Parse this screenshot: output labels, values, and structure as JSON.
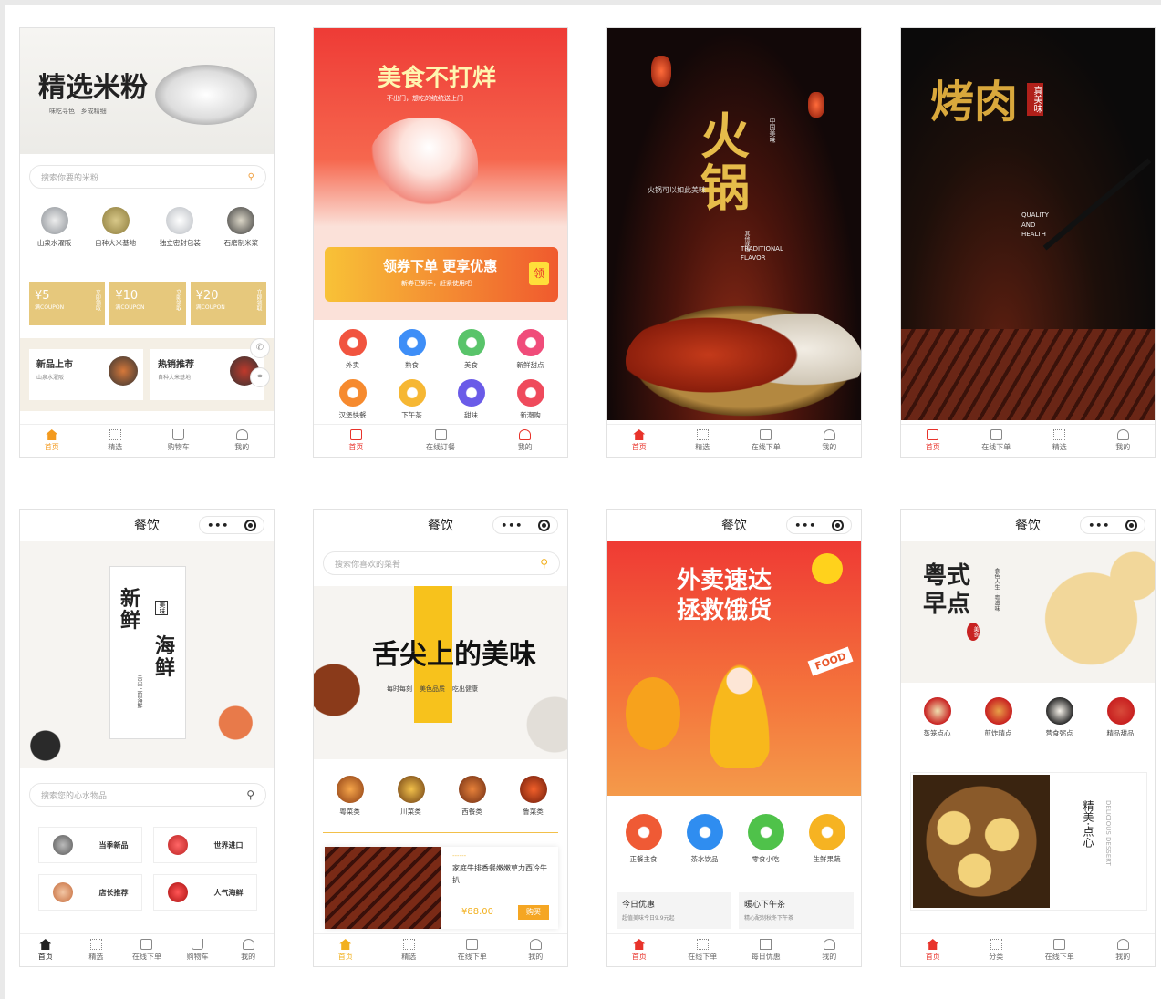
{
  "colors": {
    "accent": "#e8332b",
    "orange": "#f6a623",
    "gold": "#d9b24a"
  },
  "cards": {
    "c1": {
      "banner_title": "精选米粉",
      "banner_sub": "味吃寻色 · 乡成精细",
      "search_placeholder": "搜索你要的米粉",
      "categories": [
        "山泉水濯阪",
        "自种大米基地",
        "独立密封包装",
        "石磨制米浆"
      ],
      "coupons": [
        {
          "amount": "¥5",
          "label": "满COUPON",
          "side": "立即领取"
        },
        {
          "amount": "¥10",
          "label": "满COUPON",
          "side": "立即领取"
        },
        {
          "amount": "¥20",
          "label": "满COUPON",
          "side": "立即领取"
        }
      ],
      "promos": [
        {
          "title": "新品上市",
          "sub": "山泉水濯阪"
        },
        {
          "title": "热销推荐",
          "sub": "自种大米基地"
        }
      ],
      "tabs": [
        "首页",
        "精选",
        "购物车",
        "我的"
      ]
    },
    "c2": {
      "banner_title": "美食不打烊",
      "banner_sub": "不出门，想吃的统统送上门",
      "coupon_title": "领券下单 更享优惠",
      "coupon_sub": "新券已到手，赶紧使用吧",
      "coupon_badge": "领",
      "grid": [
        "外卖",
        "熟食",
        "美食",
        "新鲜甜点",
        "汉堡快餐",
        "下午茶",
        "甜味",
        "新潮购"
      ],
      "tabs": [
        "首页",
        "在线订餐",
        "我的"
      ]
    },
    "c3": {
      "title": "火锅",
      "vertical": "中国美味",
      "slogan": "火锅可以如此美味",
      "side": "其他味道",
      "en1": "TRADITIONAL",
      "en2": "FLAVOR",
      "tabs": [
        "首页",
        "精选",
        "在线下单",
        "我的"
      ]
    },
    "c4": {
      "title": "烤肉",
      "seal": "真美味",
      "en1": "QUALITY",
      "en2": "AND",
      "en3": "HEALTH",
      "tabs": [
        "首页",
        "在线下单",
        "精选",
        "我的"
      ]
    },
    "c5": {
      "header": "餐饮",
      "title_a": "新鲜",
      "title_b": "海鲜",
      "seal": "美味",
      "sub": "舌尖上的海鲜",
      "search_placeholder": "搜索您的心水物品",
      "tiles": [
        "当季新品",
        "世界进口",
        "店长推荐",
        "人气海鲜"
      ],
      "tabs": [
        "首页",
        "精选",
        "在线下单",
        "购物车",
        "我的"
      ]
    },
    "c6": {
      "header": "餐饮",
      "search_placeholder": "搜索你喜欢的菜肴",
      "title": "舌尖上的美味",
      "tags": [
        "每时每刻",
        "美色品质",
        "吃出健康"
      ],
      "grid": [
        "粤菜类",
        "川菜类",
        "西餐类",
        "鲁菜类"
      ],
      "product_tag": "------",
      "product_name": "家庭牛排香餐嫩嫩草力西冷牛扒",
      "price": "¥88.00",
      "buy": "购买",
      "tabs": [
        "首页",
        "精选",
        "在线下单",
        "我的"
      ]
    },
    "c7": {
      "header": "餐饮",
      "title_a": "外卖速达",
      "title_b": "拯救饿货",
      "food": "FOOD",
      "grid": [
        "正餐主食",
        "茶水饮品",
        "零食小吃",
        "生鲜果蔬"
      ],
      "deals": [
        {
          "title": "今日优惠",
          "sub": "超值美味今日9.9元起"
        },
        {
          "title": "暖心下午茶",
          "sub": "精心配制秋冬下午茶"
        }
      ],
      "tabs": [
        "首页",
        "在线下单",
        "每日优惠",
        "我的"
      ]
    },
    "c8": {
      "header": "餐饮",
      "title_a": "粤式",
      "title_b": "早点",
      "seal": "美食",
      "vert": "食色人生 · 粤滋味",
      "grid": [
        "蒸笼点心",
        "煎炸精点",
        "营食粥点",
        "精品甜品"
      ],
      "side_text": "精美·点心",
      "side_en": "DELICIOUS DESSERT",
      "tabs": [
        "首页",
        "分类",
        "在线下单",
        "我的"
      ]
    }
  }
}
